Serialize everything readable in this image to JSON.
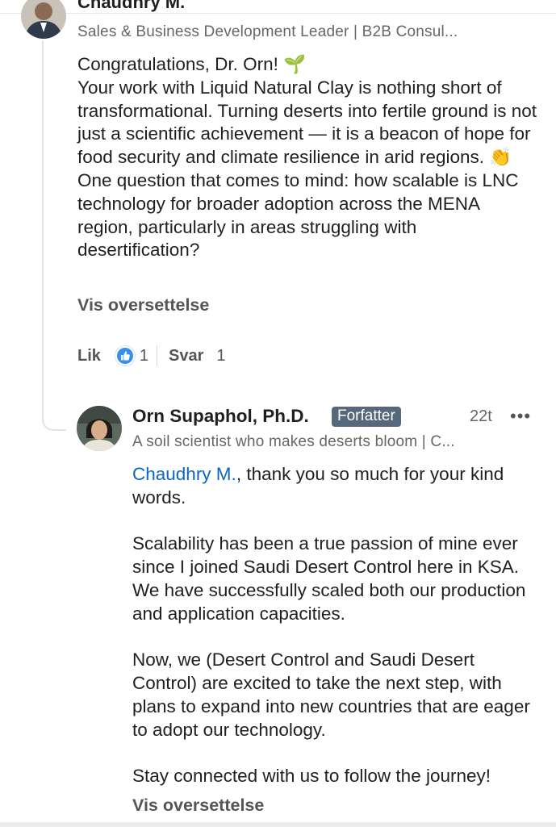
{
  "top_comment": {
    "author_name": "Chaudhry M.",
    "headline": "Sales & Business Development Leader | B2B Consul...",
    "lines": [
      "Congratulations, Dr. Orn! 🌱",
      "Your work with Liquid Natural Clay is nothing short of transformational. Turning deserts into fertile ground is not just a scientific achievement — it is a beacon of hope for food security and climate resilience in arid regions. 👏",
      "One question that comes to mind: how scalable is LNC technology for broader adoption across the MENA region, particularly in areas struggling with desertification?"
    ],
    "translate_label": "Vis oversettelse",
    "like_label": "Lik",
    "like_count": "1",
    "reply_label": "Svar",
    "reply_count": "1"
  },
  "reply": {
    "author_name": "Orn Supaphol, Ph.D.",
    "badge": "Forfatter",
    "time": "22t",
    "more": "•••",
    "headline": "A soil scientist who makes deserts bloom | C...",
    "mention": "Chaudhry M.",
    "first_paragraph_rest": ", thank you so much for your kind words.",
    "paragraphs": [
      "Scalability has been a true passion of mine ever since I joined Saudi Desert Control here in KSA. We have successfully scaled both our production and application capacities.",
      "Now, we (Desert Control and Saudi Desert Control) are excited to take the next step, with plans to expand into new countries that are eager to adopt our technology.",
      "Stay connected with us to follow the journey!"
    ],
    "translate_label": "Vis oversettelse"
  },
  "colors": {
    "link_blue": "#0a66c2",
    "like_blue": "#378fe9",
    "badge_bg": "#56687a",
    "secondary_text": "#666666"
  }
}
